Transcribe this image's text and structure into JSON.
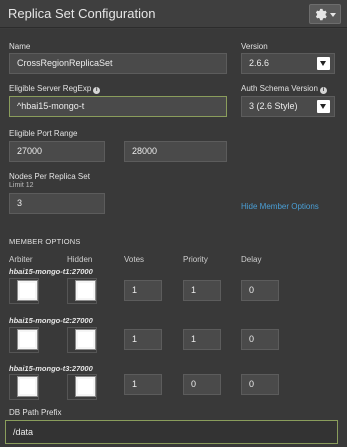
{
  "header": {
    "title": "Replica Set Configuration",
    "gear_icon": "gear-icon"
  },
  "fields": {
    "name": {
      "label": "Name",
      "value": "CrossRegionReplicaSet"
    },
    "version": {
      "label": "Version",
      "value": "2.6.6"
    },
    "eligible_server_regexp": {
      "label": "Eligible Server RegExp",
      "info": "i",
      "value": "^hbai15-mongo-t"
    },
    "auth_schema_version": {
      "label": "Auth Schema Version",
      "info": "i",
      "value": "3 (2.6 Style)"
    },
    "eligible_port_range": {
      "label": "Eligible Port Range",
      "from": "27000",
      "to": "28000"
    },
    "nodes_per_replica_set": {
      "label": "Nodes Per Replica Set",
      "limit": "Limit 12",
      "value": "3"
    },
    "hide_member_options": "Hide Member Options"
  },
  "member_options": {
    "section_title": "MEMBER OPTIONS",
    "columns": [
      "Arbiter",
      "Hidden",
      "Votes",
      "Priority",
      "Delay"
    ],
    "members": [
      {
        "host": "hbai15-mongo-t1:27000",
        "arbiter": false,
        "hidden": false,
        "votes": "1",
        "priority": "1",
        "delay": "0"
      },
      {
        "host": "hbai15-mongo-t2:27000",
        "arbiter": false,
        "hidden": false,
        "votes": "1",
        "priority": "1",
        "delay": "0"
      },
      {
        "host": "hbai15-mongo-t3:27000",
        "arbiter": false,
        "hidden": false,
        "votes": "1",
        "priority": "0",
        "delay": "0"
      }
    ]
  },
  "db_path": {
    "label": "DB Path Prefix",
    "value": "/data"
  }
}
